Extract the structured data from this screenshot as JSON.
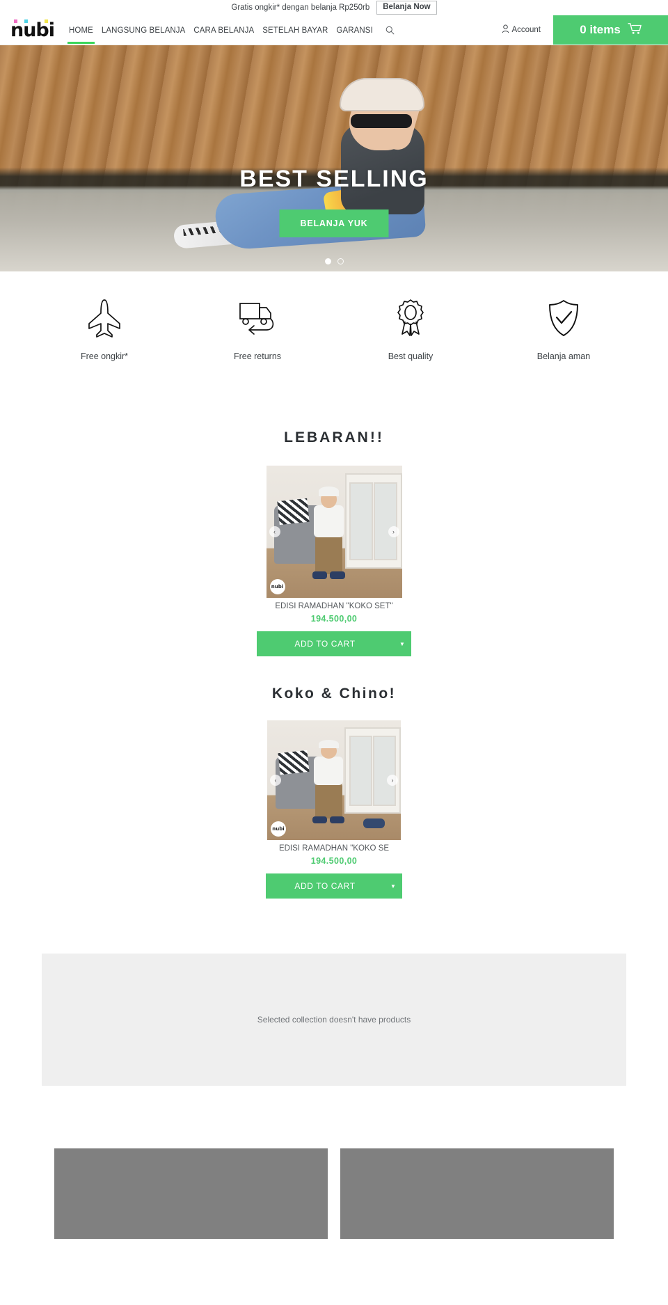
{
  "announcement": {
    "text": "Gratis ongkir* dengan belanja Rp250rb",
    "button_label": "Belanja Now"
  },
  "header": {
    "logo_text": "nubi",
    "logo_dot_colors": [
      "#f06ec4",
      "#4fd2e6",
      "#f2e54c"
    ],
    "nav": [
      {
        "label": "HOME",
        "active": true
      },
      {
        "label": "LANGSUNG BELANJA",
        "active": false
      },
      {
        "label": "CARA BELANJA",
        "active": false
      },
      {
        "label": "SETELAH BAYAR",
        "active": false
      },
      {
        "label": "GARANSI",
        "active": false
      }
    ],
    "search_icon": "search-icon",
    "account_label": "Account",
    "account_icon": "user-icon",
    "cart_label": "0 items",
    "cart_icon": "shopping-cart-icon",
    "cart_color": "#4ecb71"
  },
  "hero": {
    "title": "BEST SELLING",
    "cta_label": "BELANJA YUK",
    "cta_color": "#4ecb71",
    "slide_count": 2,
    "active_slide": 1
  },
  "features": [
    {
      "label": "Free ongkir*",
      "icon": "airplane-icon"
    },
    {
      "label": "Free returns",
      "icon": "return-truck-icon"
    },
    {
      "label": "Best quality",
      "icon": "award-ribbon-icon"
    },
    {
      "label": "Belanja aman",
      "icon": "shield-check-icon"
    }
  ],
  "sections": [
    {
      "title": "LEBARAN!!",
      "product": {
        "title": "EDISI RAMADHAN \"KOKO SET\"",
        "price": "194.500,00",
        "add_to_cart_label": "ADD TO CART",
        "badge": "nubi"
      }
    },
    {
      "title": "Koko & Chino!",
      "product": {
        "title": "EDISI RAMADHAN \"KOKO SE",
        "price": "194.500,00",
        "add_to_cart_label": "ADD TO CART",
        "badge": "nubi"
      }
    }
  ],
  "empty_collection": {
    "message": "Selected collection doesn't have products",
    "background": "#efefef"
  },
  "placeholders": {
    "count": 2,
    "color": "#808080"
  }
}
